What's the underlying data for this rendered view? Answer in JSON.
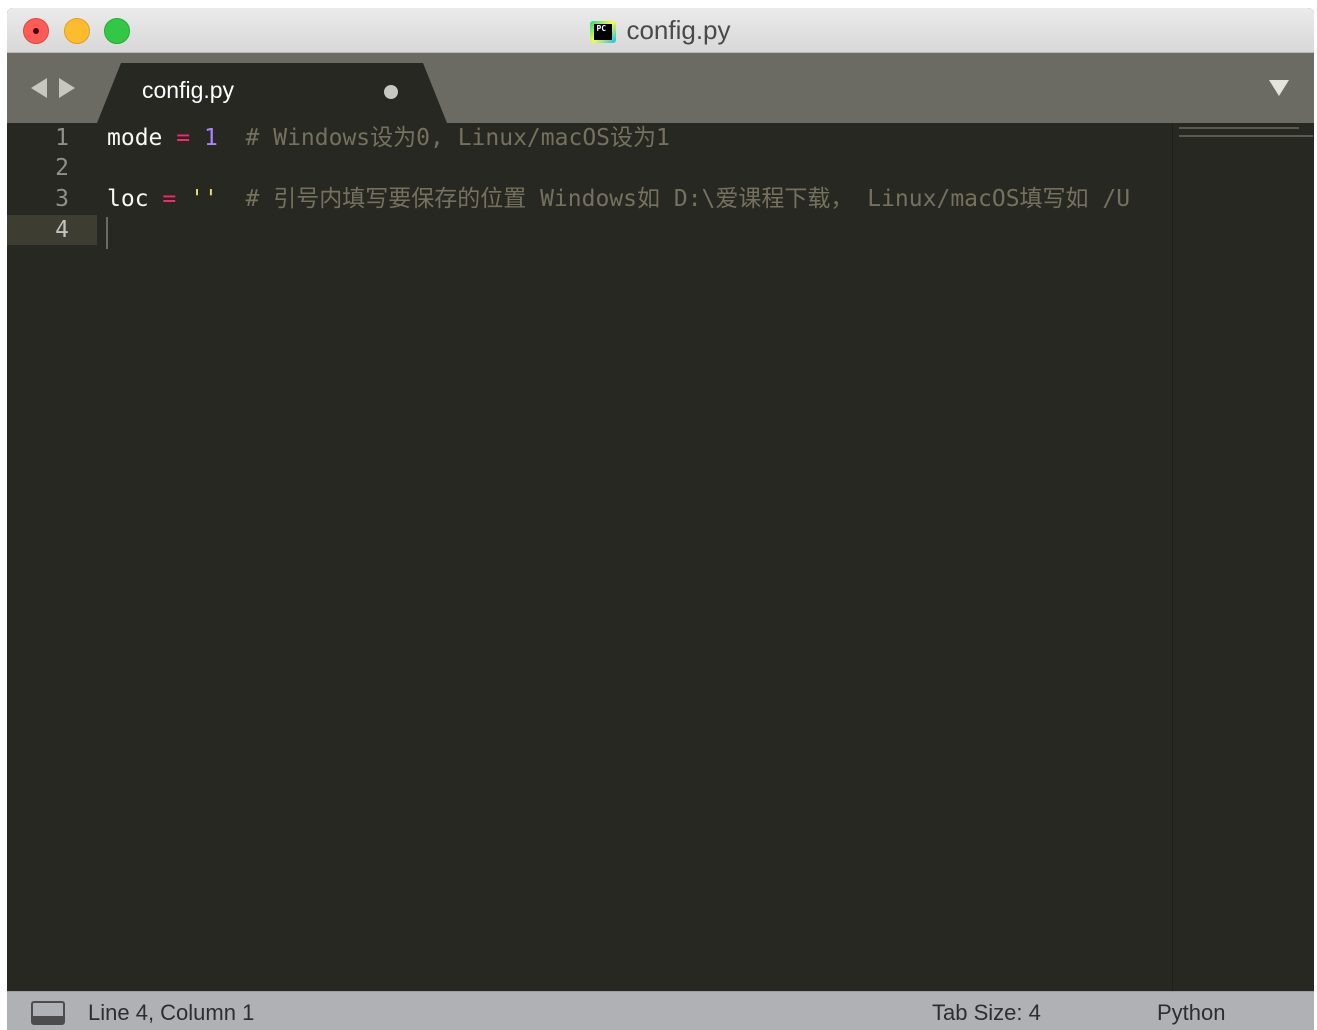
{
  "window": {
    "title": "config.py",
    "app_icon_text": "PC"
  },
  "tabs": [
    {
      "label": "config.py",
      "dirty": true
    }
  ],
  "editor": {
    "line_numbers": [
      "1",
      "2",
      "3",
      "4"
    ],
    "active_line": "4",
    "lines": [
      {
        "var": "mode",
        "op": "=",
        "value": "1",
        "comment": "# Windows设为0, Linux/macOS设为1"
      },
      {},
      {
        "var": "loc",
        "op": "=",
        "value": "''",
        "comment": "# 引号内填写要保存的位置 Windows如 D:\\爱课程下载， Linux/macOS填写如 /U"
      },
      {}
    ]
  },
  "statusbar": {
    "position": "Line 4, Column 1",
    "tab_size": "Tab Size: 4",
    "syntax": "Python"
  },
  "colors": {
    "background": "#272822",
    "keyword_operator": "#f92672",
    "number": "#ae81ff",
    "string": "#e6db74",
    "comment": "#75715e"
  }
}
